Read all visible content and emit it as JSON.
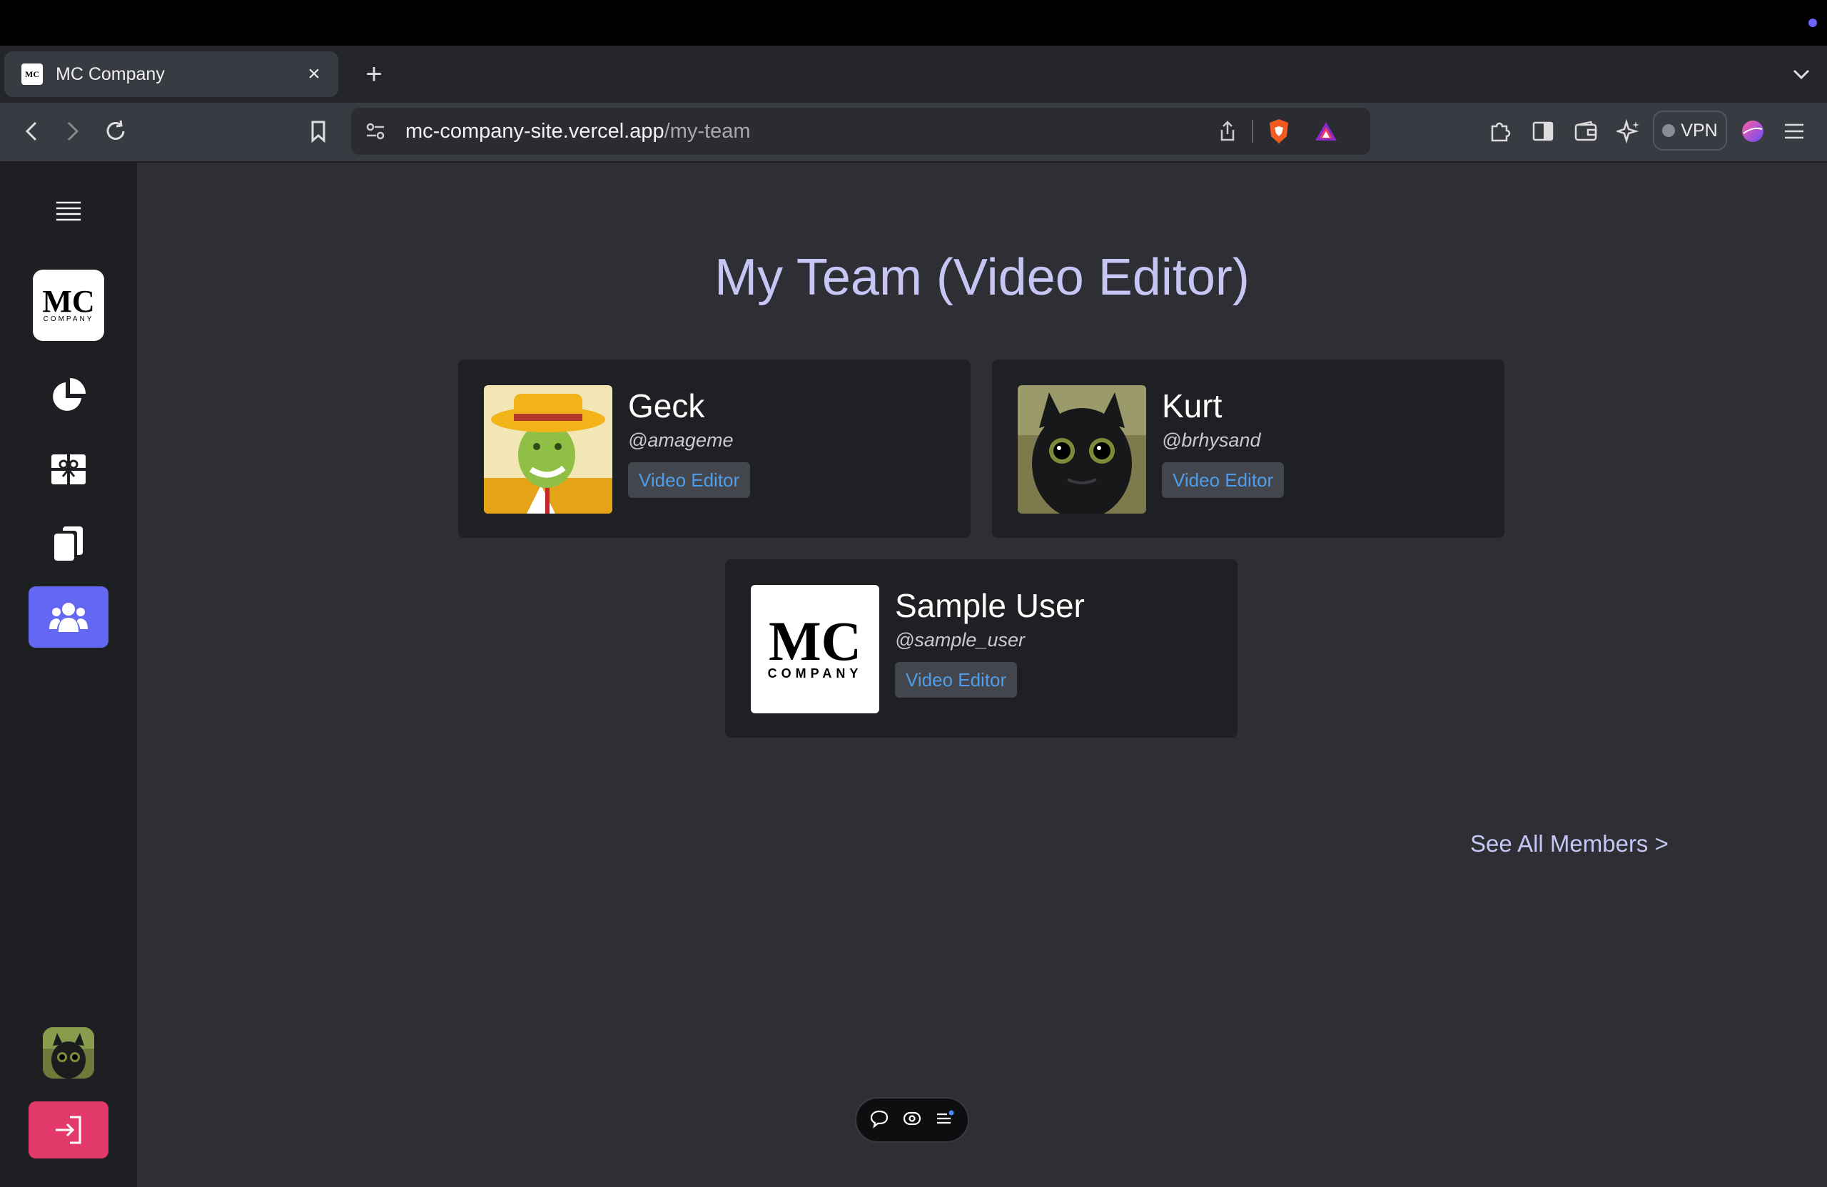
{
  "browser": {
    "tab_title": "MC Company",
    "favicon_text": "MC",
    "url_domain": "mc-company-site.vercel.app",
    "url_path": "/my-team",
    "vpn_label": "VPN"
  },
  "sidebar": {
    "logo_mc": "MC",
    "logo_company": "COMPANY",
    "nav_icons": [
      "hamburger-icon",
      "pie-chart-icon",
      "gift-icon",
      "copy-icon",
      "users-icon"
    ],
    "active_item": "users-icon",
    "active_color": "#6467f2",
    "logout_color": "#e23b6b"
  },
  "main": {
    "title": "My Team (Video Editor)",
    "see_all": "See All Members >",
    "members": [
      {
        "name": "Geck",
        "handle": "@amageme",
        "role": "Video Editor"
      },
      {
        "name": "Kurt",
        "handle": "@brhysand",
        "role": "Video Editor"
      },
      {
        "name": "Sample User",
        "handle": "@sample_user",
        "role": "Video Editor",
        "avatar_mc": "MC",
        "avatar_company": "COMPANY"
      }
    ]
  },
  "colors": {
    "title": "#c8c5f5",
    "badge_text": "#4f9de8",
    "card_bg": "#1f2024",
    "page_bg": "#2e2f34"
  }
}
